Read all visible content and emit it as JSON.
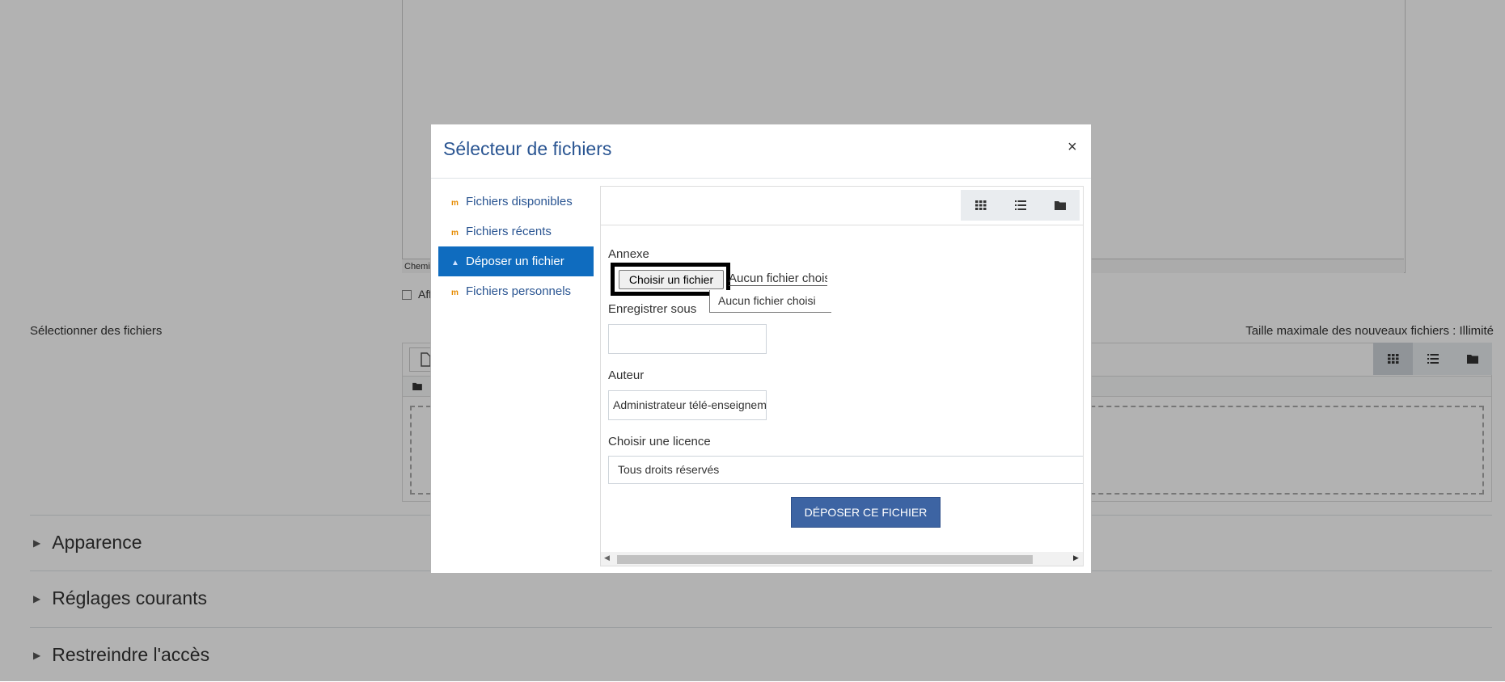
{
  "background": {
    "editor_status": "Chemin",
    "editor_checkbox_label": "Aff",
    "files_label": "Sélectionner des fichiers",
    "max_size": "Taille maximale des nouveaux fichiers : Illimité",
    "sections": [
      {
        "label": "Apparence"
      },
      {
        "label": "Réglages courants"
      },
      {
        "label": "Restreindre l'accès"
      }
    ]
  },
  "dialog": {
    "title": "Sélecteur de fichiers",
    "close": "×",
    "nav": [
      {
        "label": "Fichiers disponibles",
        "icon": "moodle-icon",
        "active": false
      },
      {
        "label": "Fichiers récents",
        "icon": "moodle-icon",
        "active": false
      },
      {
        "label": "Déposer un fichier",
        "icon": "upload-icon",
        "active": true
      },
      {
        "label": "Fichiers personnels",
        "icon": "moodle-icon",
        "active": false
      }
    ],
    "view_icons": [
      "grid-icon",
      "list-icon",
      "folder-icon"
    ],
    "form": {
      "attachment_label": "Annexe",
      "choose_file_button": "Choisir un fichier",
      "file_status": "Aucun fichier choisi",
      "file_tooltip": "Aucun fichier choisi",
      "save_as_label": "Enregistrer sous",
      "save_as_value": "",
      "author_label": "Auteur",
      "author_value": "Administrateur télé-enseignement",
      "licence_label": "Choisir une licence",
      "licence_value": "Tous droits réservés",
      "upload_button": "Déposer ce fichier"
    }
  }
}
